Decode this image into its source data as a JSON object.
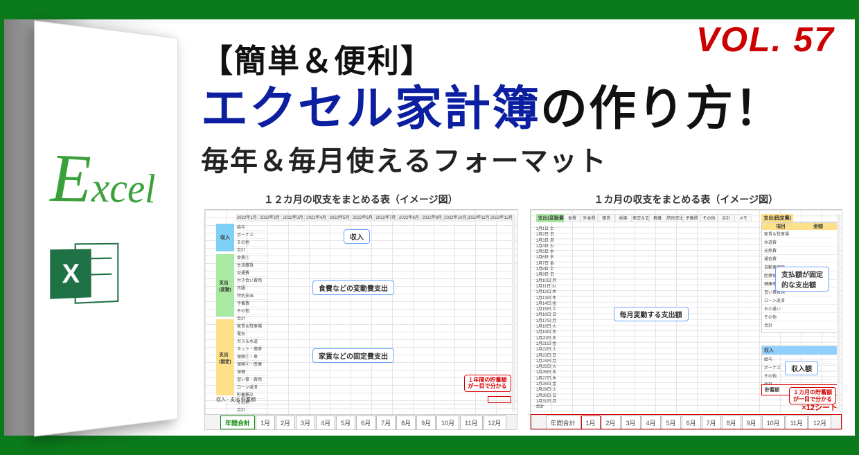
{
  "volume": "VOL. 57",
  "headline": {
    "line1": "【簡単＆便利】",
    "line2a": "エクセル家計簿",
    "line2b": "の作り方！",
    "line3": "毎年＆毎月使えるフォーマット"
  },
  "logo": {
    "letter": "E",
    "rest": "xcel",
    "icon_x": "X"
  },
  "fig_left": {
    "title": "１２カ月の収支をまとめる表（イメージ図）",
    "months": [
      "2022年1月",
      "2022年2月",
      "2022年3月",
      "2022年4月",
      "2022年5月",
      "2022年6月",
      "2022年7月",
      "2022年8月",
      "2022年9月",
      "2022年10月",
      "2022年11月",
      "2022年12月"
    ],
    "blocks": {
      "income": "収入",
      "variable": "支出\n(変動)",
      "fixed": "支出\n(固定)"
    },
    "cats_income": [
      "給与",
      "ボーナス",
      "その他",
      "合計"
    ],
    "cats_var": [
      "食費①",
      "生活雑貨",
      "交通費",
      "付き合い費用",
      "衣服",
      "特別支出",
      "予備費",
      "その他",
      "合計"
    ],
    "cats_fixed": [
      "家賃＆駐車場",
      "電気",
      "ガス＆水道",
      "ネット・携帯",
      "保険①・車",
      "保険②・医療",
      "保健",
      "習い事・費用",
      "ローン返済",
      "貯蓄積立",
      "その他",
      "合計"
    ],
    "labels": {
      "income": "収入",
      "variable": "食費などの変動費支出",
      "fixed": "家賃などの固定費支出"
    },
    "callout": "１年間の貯蓄額\nが一目で分かる",
    "total_row": "収入 - 支出   貯蓄額",
    "tabs": [
      "年間合計",
      "1月",
      "2月",
      "3月",
      "4月",
      "5月",
      "6月",
      "7月",
      "8月",
      "9月",
      "10月",
      "11月",
      "12月"
    ]
  },
  "fig_right": {
    "title": "１カ月の収支をまとめる表（イメージ図）",
    "var_header": "支出(変動費)",
    "fixed_header": "支出(固定費)",
    "var_cols": [
      "食費",
      "外食費",
      "雑貨",
      "娯楽",
      "車交＆交通費",
      "教養",
      "特別支出",
      "予備費",
      "その他",
      "合計",
      "メモ"
    ],
    "days": [
      "1月1日 土",
      "1月2日 日",
      "1月3日 月",
      "1月4日 火",
      "1月5日 水",
      "1月6日 木",
      "1月7日 金",
      "1月8日 土",
      "1月9日 日",
      "1月10日 月",
      "1月11日 火",
      "1月12日 水",
      "1月13日 木",
      "1月14日 金",
      "1月15日 土",
      "1月16日 日",
      "1月17日 月",
      "1月18日 火",
      "1月19日 水",
      "1月20日 木",
      "1月21日 金",
      "1月22日 土",
      "1月23日 日",
      "1月24日 月",
      "1月25日 火",
      "1月26日 水",
      "1月27日 木",
      "1月28日 金",
      "1月29日 土",
      "1月30日 日",
      "1月31日 月",
      "合計"
    ],
    "fixed_items": [
      "家賃＆駐車場",
      "水道費",
      "光熱費",
      "通信費",
      "自動車保険",
      "医療保険",
      "健康事業費",
      "習い事費用",
      "ローン返済",
      "お小遣い",
      "その他",
      "合計"
    ],
    "fixed_cols": [
      "項目",
      "金額"
    ],
    "income_header": "収入",
    "income_items": [
      "給与",
      "ボーナス",
      "その他",
      "合計"
    ],
    "save_label": "貯蓄額",
    "label_variable": "毎月変動する支出額",
    "label_fixed": "支払額が固定\n的な支出額",
    "label_income": "収入額",
    "callout": "１カ月の貯蓄額\nが一目で分かる",
    "x12": "×12シート",
    "tabs": [
      "年間合計",
      "1月",
      "2月",
      "3月",
      "4月",
      "5月",
      "6月",
      "7月",
      "8月",
      "9月",
      "10月",
      "11月",
      "12月"
    ]
  }
}
